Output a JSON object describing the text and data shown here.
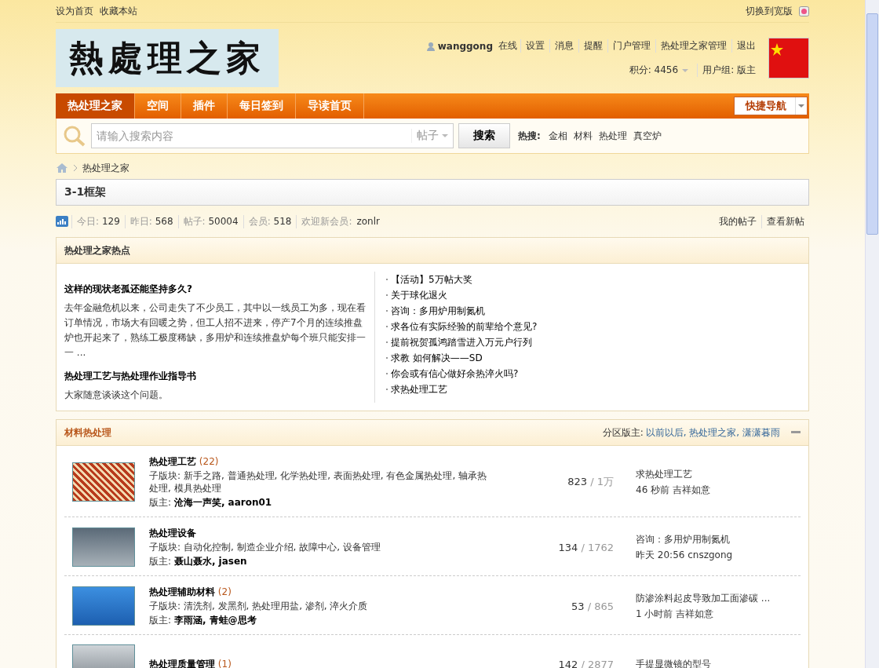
{
  "top_bar": {
    "links": [
      "设为首页",
      "收藏本站"
    ],
    "wide_toggle": "切换到宽版"
  },
  "logo": {
    "text": "熱處理之家"
  },
  "user": {
    "name": "wanggong",
    "status": "在线",
    "links": [
      "设置",
      "消息",
      "提醒",
      "门户管理",
      "热处理之家管理",
      "退出"
    ],
    "points": "积分: 4456",
    "group": "用户组: 版主"
  },
  "nav": {
    "items": [
      {
        "label": "热处理之家",
        "selected": true
      },
      {
        "label": "空间",
        "selected": false
      },
      {
        "label": "插件",
        "selected": false
      },
      {
        "label": "每日签到",
        "selected": false
      },
      {
        "label": "导读首页",
        "selected": false
      }
    ],
    "quick_nav": "快捷导航"
  },
  "search": {
    "placeholder": "请输入搜索内容",
    "scope": "帖子",
    "button": "搜索",
    "hot_label": "热搜:",
    "hot": [
      "金相",
      "材料",
      "热处理",
      "真空炉"
    ]
  },
  "breadcrumb": [
    "热处理之家"
  ],
  "page_title": "3-1框架",
  "stats": {
    "items": [
      {
        "label": "今日:",
        "value": "129"
      },
      {
        "label": "昨日:",
        "value": "568"
      },
      {
        "label": "帖子:",
        "value": "50004"
      },
      {
        "label": "会员:",
        "value": "518"
      }
    ],
    "new_member_label": "欢迎新会员:",
    "new_member": "zonlr",
    "links": [
      "我的帖子",
      "查看新帖"
    ]
  },
  "hot": {
    "title": "热处理之家热点",
    "articles": [
      {
        "title": "这样的现状老孤还能坚持多久?",
        "summary": "去年金融危机以来，公司走失了不少员工，其中以一线员工为多，现在看订单情况，市场大有回暖之势，但工人招不进来，停产7个月的连续推盘炉也开起来了，熟练工极度稀缺，多用炉和连续推盘炉每个班只能安排一一 ..."
      },
      {
        "title": "热处理工艺与热处理作业指导书",
        "summary": "大家随意谈谈这个问题。"
      }
    ],
    "list": [
      "【活动】5万帖大奖",
      "关于球化退火",
      "咨询：多用炉用制氮机",
      "求各位有实际经验的前辈给个意见?",
      "提前祝贺孤鸿踏雪进入万元户行列",
      "求教 如何解决——SD",
      "你会或有信心做好余热淬火吗?",
      "求热处理工艺"
    ]
  },
  "category": {
    "title": "材料热处理",
    "moderators_label": "分区版主:",
    "moderators": "以前以后, 热处理之家, 潇潇暮雨",
    "count_separator": "/",
    "forums": [
      {
        "name": "热处理工艺",
        "count": "(22)",
        "subforums_label": "子版块:",
        "subforums": "新手之路, 普通热处理, 化学热处理, 表面热处理, 有色金属热处理, 轴承热处理, 模具热处理",
        "moderators_label": "版主:",
        "moderators": "沧海一声笑, aaron01",
        "threads": "823",
        "posts": "1万",
        "last_title": "求热处理工艺",
        "last_meta": "46 秒前 吉祥如意"
      },
      {
        "name": "热处理设备",
        "subforums_label": "子版块:",
        "subforums": "自动化控制, 制造企业介绍, 故障中心, 设备管理",
        "moderators_label": "版主:",
        "moderators": "聂山聂水, jasen",
        "threads": "134",
        "posts": "1762",
        "last_title": "咨询：多用炉用制氮机",
        "last_meta": "昨天 20:56 cnszgong"
      },
      {
        "name": "热处理辅助材料",
        "count": "(2)",
        "subforums_label": "子版块:",
        "subforums": "清洗剂, 发黑剂, 热处理用盐, 渗剂, 淬火介质",
        "moderators_label": "版主:",
        "moderators": "李雨涵, 青蛙@思考",
        "threads": "53",
        "posts": "865",
        "last_title": "防渗涂料起皮导致加工面渗碳 ...",
        "last_meta": "1 小时前 吉祥如意"
      },
      {
        "name": "热处理质量管理",
        "count": "(1)",
        "threads": "142",
        "posts": "2877",
        "last_title": "手提显微镜的型号"
      }
    ]
  }
}
